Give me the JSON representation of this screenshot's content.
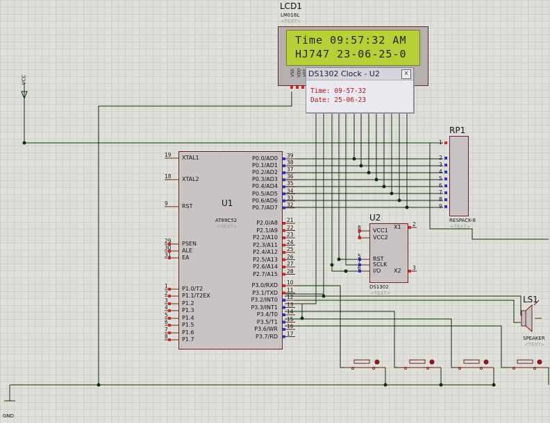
{
  "colors": {
    "wire": "#102c10",
    "pin_red": "#e02020",
    "pin_blue": "#2030e0",
    "body": "#c8c4c4",
    "outline": "#6a2020",
    "lcd_screen": "#b8cf35"
  },
  "lcd": {
    "ref": "LCD1",
    "part": "LM016L",
    "text": "<TEXT>",
    "line1": "Time 09:57:32 AM",
    "line2": "HJ747 23-06-25-0",
    "pins": [
      "VSS",
      "VDD",
      "VEE"
    ]
  },
  "popup": {
    "title": "DS1302 Clock - U2",
    "close": "x",
    "time_label": "Time:",
    "time_value": "09-57-32",
    "date_label": "Date:",
    "date_value": "25-06-23"
  },
  "power": {
    "vcc": "VCC",
    "gnd": "GND"
  },
  "u1": {
    "ref": "U1",
    "part": "AT89C52",
    "text": "<TEXT>",
    "left_pins": [
      [
        "19",
        "XTAL1"
      ],
      [
        "18",
        "XTAL2"
      ],
      [
        "9",
        "RST"
      ],
      [
        "29",
        "PSEN"
      ],
      [
        "30",
        "ALE"
      ],
      [
        "31",
        "EA"
      ],
      [
        "1",
        "P1.0/T2"
      ],
      [
        "2",
        "P1.1/T2EX"
      ],
      [
        "3",
        "P1.2"
      ],
      [
        "4",
        "P1.3"
      ],
      [
        "5",
        "P1.4"
      ],
      [
        "6",
        "P1.5"
      ],
      [
        "7",
        "P1.6"
      ],
      [
        "8",
        "P1.7"
      ]
    ],
    "right_pins": [
      [
        "39",
        "P0.0/AD0"
      ],
      [
        "38",
        "P0.1/AD1"
      ],
      [
        "37",
        "P0.2/AD2"
      ],
      [
        "36",
        "P0.3/AD3"
      ],
      [
        "35",
        "P0.4/AD4"
      ],
      [
        "34",
        "P0.5/AD5"
      ],
      [
        "33",
        "P0.6/AD6"
      ],
      [
        "32",
        "P0.7/AD7"
      ],
      [
        "21",
        "P2.0/A8"
      ],
      [
        "22",
        "P2.1/A9"
      ],
      [
        "23",
        "P2.2/A10"
      ],
      [
        "24",
        "P2.3/A11"
      ],
      [
        "25",
        "P2.4/A12"
      ],
      [
        "26",
        "P2.5/A13"
      ],
      [
        "27",
        "P2.6/A14"
      ],
      [
        "28",
        "P2.7/A15"
      ],
      [
        "10",
        "P3.0/RXD"
      ],
      [
        "11",
        "P3.1/TXD"
      ],
      [
        "12",
        "P3.2/INT0"
      ],
      [
        "13",
        "P3.3/INT1"
      ],
      [
        "14",
        "P3.4/T0"
      ],
      [
        "15",
        "P3.5/T1"
      ],
      [
        "16",
        "P3.6/WR"
      ],
      [
        "17",
        "P3.7/RD"
      ]
    ]
  },
  "u2": {
    "ref": "U2",
    "part": "DS1302",
    "text": "<TEXT>",
    "left_pins": [
      [
        "8",
        "VCC1"
      ],
      [
        "1",
        "VCC2"
      ],
      [
        "5",
        "RST"
      ],
      [
        "7",
        "SCLK"
      ],
      [
        "6",
        "I/O"
      ]
    ],
    "right_pins": [
      [
        "2",
        "X1"
      ],
      [
        "3",
        "X2"
      ]
    ]
  },
  "rp1": {
    "ref": "RP1",
    "part": "RESPACK-8",
    "text": "<TEXT>",
    "pins": [
      "1",
      "2",
      "3",
      "4",
      "5",
      "6",
      "7",
      "8",
      "9"
    ]
  },
  "ls1": {
    "ref": "LS1",
    "part": "SPEAKER",
    "text": "<TEXT>"
  }
}
